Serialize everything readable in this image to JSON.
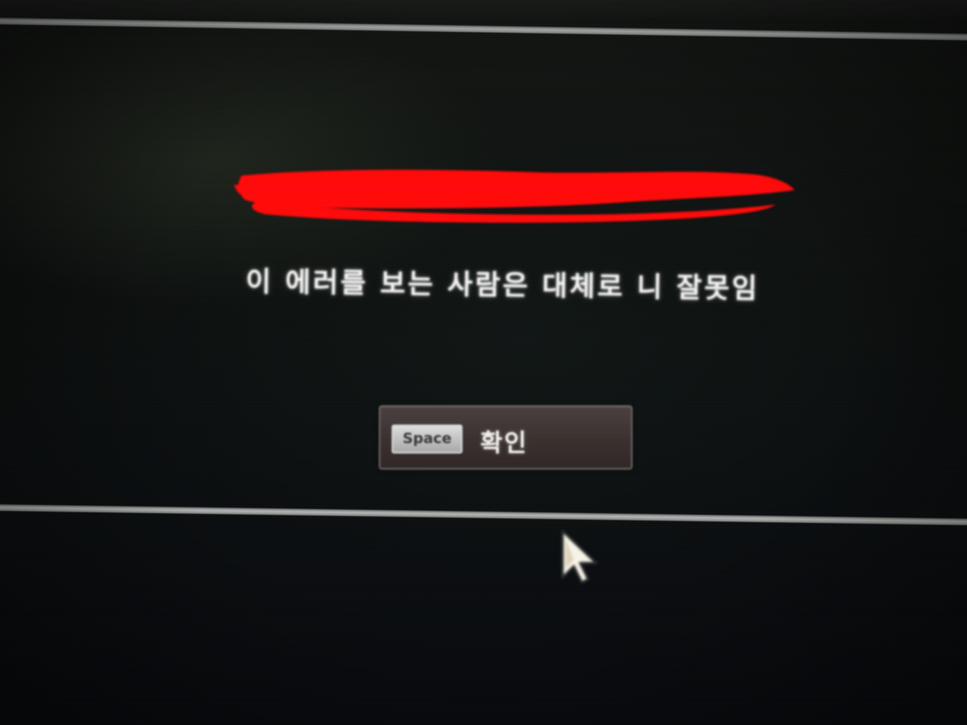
{
  "dialog": {
    "message": "이 에러를 보는 사람은 대체로 니 잘못임",
    "redacted_title_color": "#ff0a0a",
    "confirm_button": {
      "key_hint": "Space",
      "label": "확인"
    }
  },
  "colors": {
    "background": "#0b0d0c",
    "text": "#f4f4f2",
    "button_bg": "#3a312f",
    "divider": "#b9bcba"
  },
  "icons": {
    "cursor": "mouse-pointer-icon"
  }
}
